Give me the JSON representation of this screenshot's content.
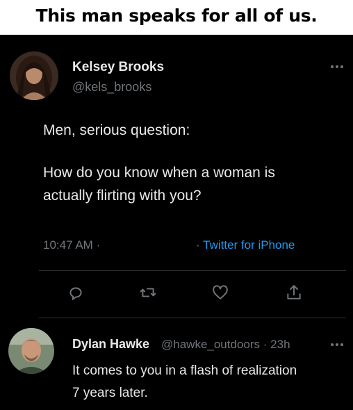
{
  "meme": {
    "title": "This man speaks for all of us."
  },
  "tweet": {
    "author_name": "Kelsey Brooks",
    "author_handle": "@kels_brooks",
    "more_icon": "more-horizontal-icon",
    "text_line_1": "Men, serious question:",
    "text_line_2": "How do you know when a woman is",
    "text_line_3": "actually flirting with you?",
    "time": "10:47 AM",
    "separator": "·",
    "source": "Twitter for iPhone",
    "actions": {
      "reply_icon": "reply-icon",
      "retweet_icon": "retweet-icon",
      "like_icon": "heart-icon",
      "share_icon": "share-icon"
    }
  },
  "reply": {
    "author_name": "Dylan Hawke",
    "author_handle": "@hawke_outdoors",
    "separator": "·",
    "time_ago": "23h",
    "more_icon": "more-horizontal-icon",
    "text_line_1": "It comes to you in a flash of realization",
    "text_line_2": "7 years later."
  },
  "colors": {
    "background": "#000000",
    "primary_text": "#e7e9ea",
    "secondary_text": "#71767b",
    "link": "#1d9bf0",
    "divider": "#2f3336",
    "banner_background": "#ffffff",
    "banner_text": "#000000"
  }
}
